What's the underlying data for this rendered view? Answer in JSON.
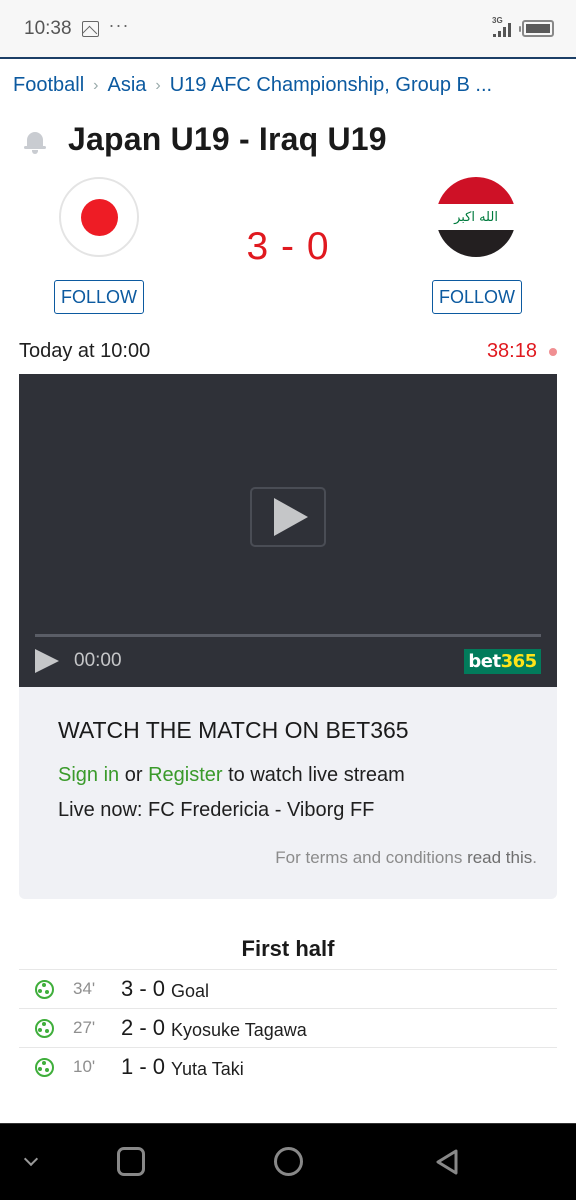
{
  "status_bar": {
    "time": "10:38",
    "dots": "···",
    "network": "3G"
  },
  "breadcrumb": [
    {
      "label": "Football"
    },
    {
      "label": "Asia"
    },
    {
      "label": "U19 AFC Championship, Group B ..."
    }
  ],
  "match": {
    "title": "Japan U19 - Iraq U19",
    "score": "3 - 0",
    "home": {
      "name": "Japan U19",
      "flag": "japan-flag",
      "follow_label": "FOLLOW"
    },
    "away": {
      "name": "Iraq U19",
      "flag": "iraq-flag",
      "flag_text": "الله اكبر",
      "follow_label": "FOLLOW"
    },
    "kickoff": "Today at 10:00",
    "live_clock": "38:18"
  },
  "video": {
    "current_time": "00:00",
    "progress": 0,
    "logo_text": "bet",
    "logo_num": "365"
  },
  "promo": {
    "title": "WATCH THE MATCH ON BET365",
    "sign_in": "Sign in",
    "or": " or ",
    "register": "Register",
    "suffix": " to watch live stream",
    "live_now": "Live now: FC Fredericia - Viborg FF",
    "terms_prefix": "For terms and conditions ",
    "terms_link": "read this",
    "terms_suffix": "."
  },
  "events": {
    "section_title": "First half",
    "items": [
      {
        "icon": "goal-ball-icon",
        "minute": "34'",
        "score": "3 - 0",
        "player": "Goal"
      },
      {
        "icon": "goal-ball-icon",
        "minute": "27'",
        "score": "2 - 0",
        "player": "Kyosuke Tagawa"
      },
      {
        "icon": "goal-ball-icon",
        "minute": "10'",
        "score": "1 - 0",
        "player": "Yuta Taki"
      }
    ]
  },
  "colors": {
    "link_blue": "#0c5aa0",
    "score_red": "#e0191f",
    "promo_green": "#3a9a2a",
    "bet365_green": "#027b5b",
    "bet365_yellow": "#ffe418"
  }
}
